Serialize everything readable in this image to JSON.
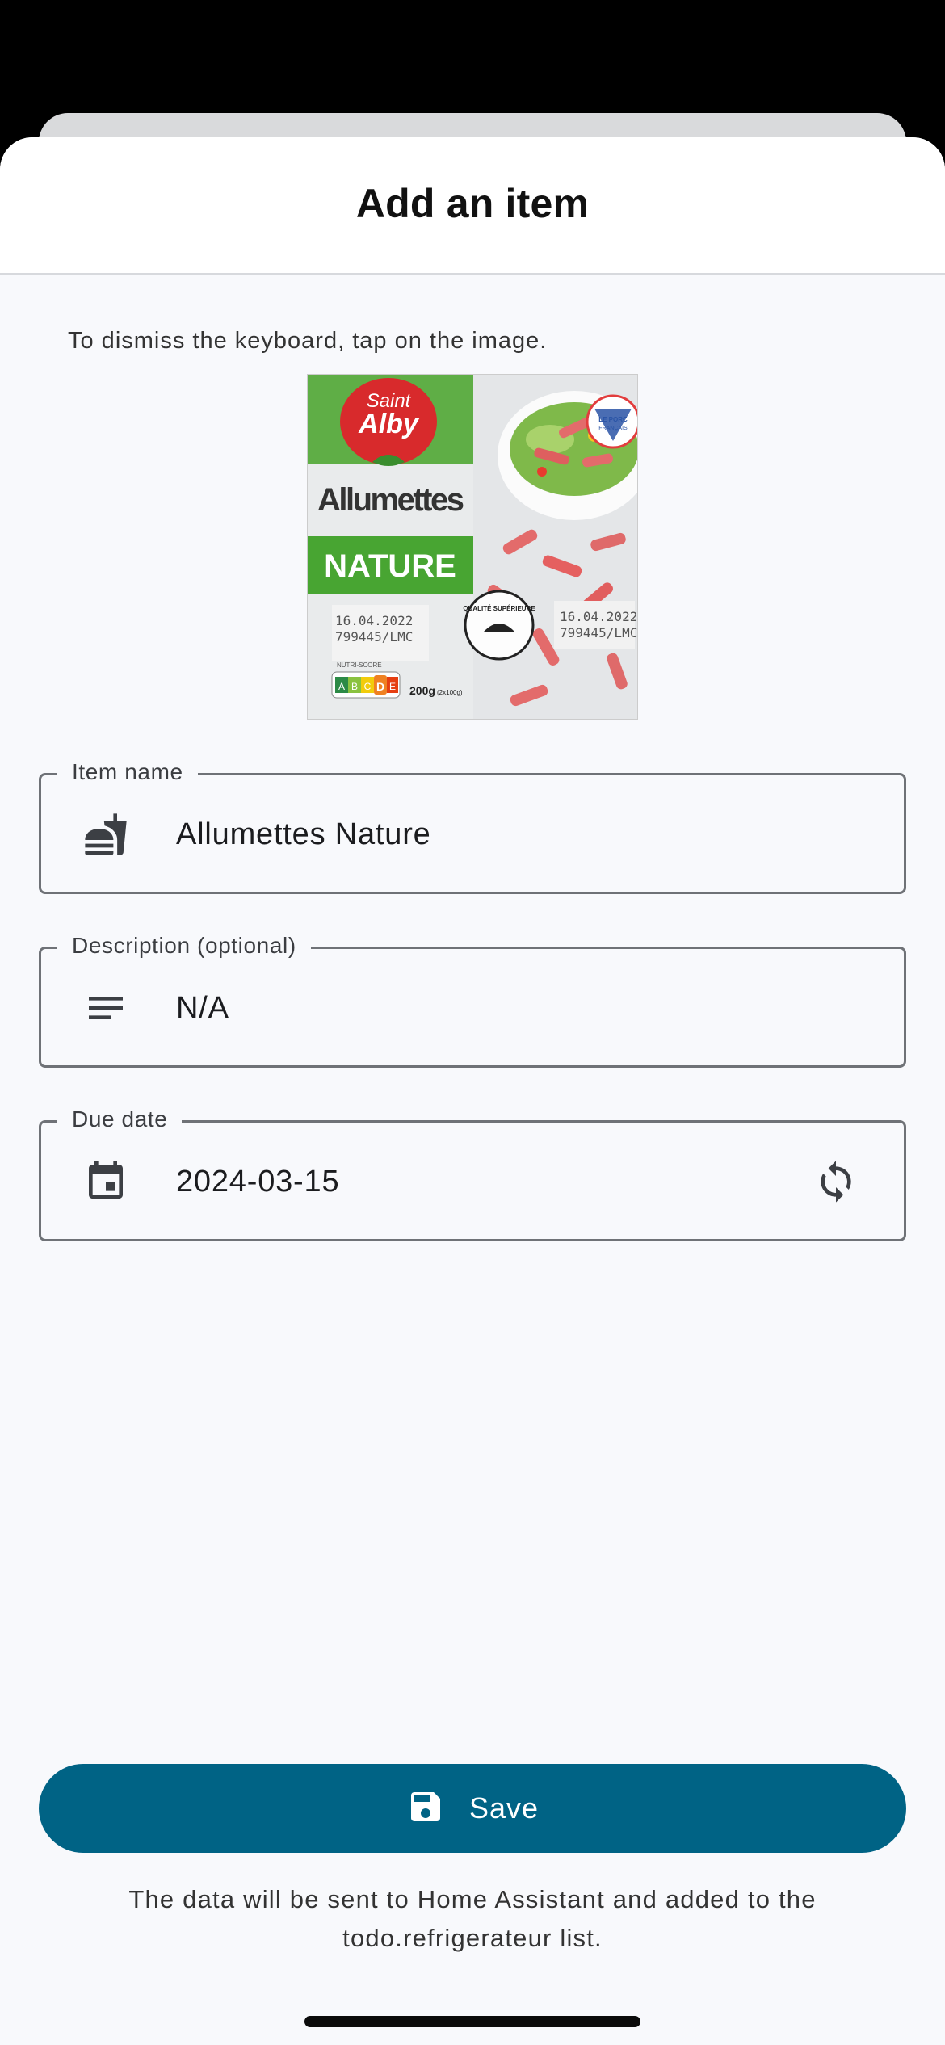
{
  "sheet": {
    "title": "Add an item",
    "hint": "To dismiss the keyboard, tap on the image."
  },
  "photo": {
    "brand_line1": "Saint",
    "brand_line2": "Alby",
    "product_name": "Allumettes",
    "product_variant": "NATURE",
    "date_code": "16.04.2022",
    "lot_code": "799445/LMC",
    "nutri_score_label": "NUTRI-SCORE",
    "nutri_score_letters": [
      "A",
      "B",
      "C",
      "D",
      "E"
    ],
    "weight": "200g",
    "weight_detail": "(2x100g)",
    "quality_badge": "QUALITÉ SUPÉRIEURE",
    "origin_badge_line1": "LE PORC",
    "origin_badge_line2": "FRANÇAIS"
  },
  "fields": {
    "item_name": {
      "label": "Item name",
      "value": "Allumettes Nature",
      "icon": "fastfood-icon"
    },
    "description": {
      "label": "Description (optional)",
      "value": "N/A",
      "icon": "notes-icon"
    },
    "due_date": {
      "label": "Due date",
      "value": "2024-03-15",
      "icon": "calendar-icon",
      "trailing_icon": "sync-icon"
    }
  },
  "actions": {
    "save_label": "Save",
    "save_icon": "save-icon"
  },
  "footer": {
    "note": "The data will be sent to Home Assistant and added to the todo.refrigerateur list."
  },
  "colors": {
    "primary": "#006385",
    "background": "#f8f9fc",
    "outline": "#6f7277"
  }
}
